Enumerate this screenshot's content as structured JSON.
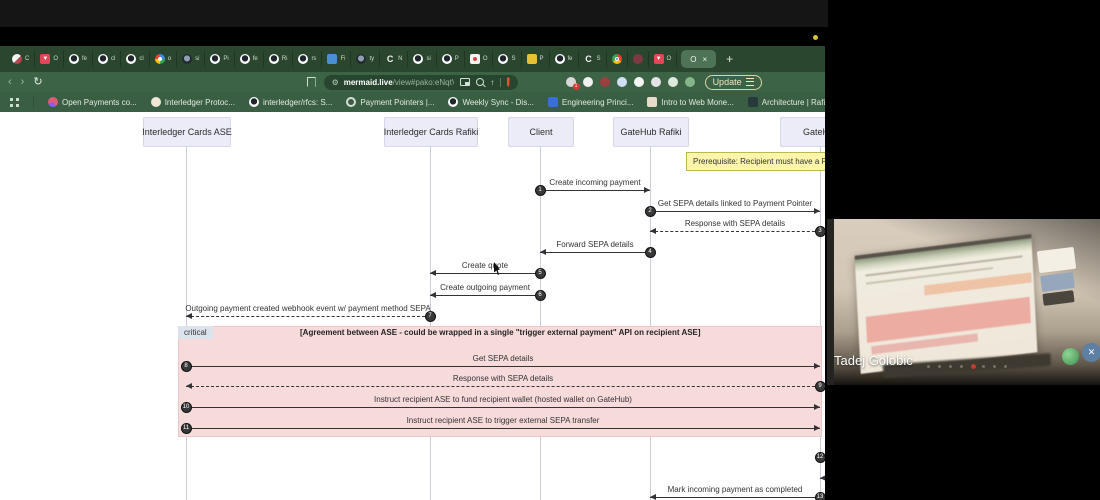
{
  "colors": {
    "brand_green": "#3d6347",
    "tabstrip_green": "#2a462f",
    "actor_fill": "#ececf8",
    "note_fill": "#fcf4a9",
    "critical_fill": "#f7dbdb",
    "arrow": "#333333"
  },
  "browser": {
    "tabs": [
      {
        "icon": "half-red",
        "label": "C"
      },
      {
        "icon": "v-logo",
        "label": "O"
      },
      {
        "icon": "github",
        "label": "fe"
      },
      {
        "icon": "github",
        "label": "cl"
      },
      {
        "icon": "github",
        "label": "cl"
      },
      {
        "icon": "google",
        "label": "o"
      },
      {
        "icon": "github-dark",
        "label": "si"
      },
      {
        "icon": "github",
        "label": "Pi"
      },
      {
        "icon": "github",
        "label": "fe"
      },
      {
        "icon": "github",
        "label": "Ri"
      },
      {
        "icon": "github",
        "label": "rs"
      },
      {
        "icon": "blue-square",
        "label": "Fi"
      },
      {
        "icon": "github-dark",
        "label": "ty"
      },
      {
        "icon": "c-white",
        "label": "N"
      },
      {
        "icon": "github",
        "label": "si"
      },
      {
        "icon": "github",
        "label": "P"
      },
      {
        "icon": "white-square",
        "label": "O"
      },
      {
        "icon": "github",
        "label": "S"
      },
      {
        "icon": "yellow-square",
        "label": "P"
      },
      {
        "icon": "github",
        "label": "fe"
      },
      {
        "icon": "c-white",
        "label": "S"
      },
      {
        "icon": "chrome",
        "label": ""
      },
      {
        "icon": "maroon-dot",
        "label": ""
      },
      {
        "icon": "v-logo",
        "label": "O"
      }
    ],
    "active_tab": {
      "label": "O",
      "close_glyph": "×"
    },
    "new_tab_label": "+",
    "url": {
      "domain": "mermaid.live",
      "path": "/view#pako:eNqtVk1v2kAQ_Suj7SWRgIDBAXxAQjRNc0iLkp4qLos92CvsXbJeQ9i…"
    },
    "update_label": "Update",
    "bookmarks": [
      {
        "icon": "openpayments",
        "label": "Open Payments co..."
      },
      {
        "icon": "cream-dot",
        "label": "Interledger Protoc..."
      },
      {
        "icon": "github",
        "label": "interledger/rfcs: S..."
      },
      {
        "icon": "ring",
        "label": "Payment Pointers |..."
      },
      {
        "icon": "github",
        "label": "Weekly Sync - Dis..."
      },
      {
        "icon": "blue-doc",
        "label": "Engineering Princi..."
      },
      {
        "icon": "slides",
        "label": "Intro to Web Mone..."
      },
      {
        "icon": "rafiki",
        "label": "Architecture | Rafiki"
      }
    ],
    "extensions": [
      {
        "name": "extension-1",
        "color": "#d8d8d8",
        "badge": "1"
      },
      {
        "name": "extension-2",
        "color": "#f0f0f0",
        "badge": ""
      },
      {
        "name": "extension-3",
        "color": "#9c3f3f",
        "badge": ""
      },
      {
        "name": "extension-4",
        "color": "#cfe0f2",
        "badge": ""
      },
      {
        "name": "extension-5",
        "color": "#f7f7f7",
        "badge": ""
      },
      {
        "name": "extension-6",
        "color": "#e4e4e4",
        "badge": ""
      },
      {
        "name": "extension-7",
        "color": "#dfe8df",
        "badge": ""
      },
      {
        "name": "extension-8",
        "color": "#86b588",
        "badge": ""
      }
    ]
  },
  "diagram": {
    "participants": [
      "Interledger Cards ASE",
      "Interledger Cards Rafiki",
      "Client",
      "GateHub Rafiki",
      "GateHub"
    ],
    "note": "Prerequisite: Recipient must have a Payme",
    "messages": [
      {
        "num": "1",
        "from": "Client",
        "to": "GateHub Rafiki",
        "text": "Create incoming payment",
        "line": "solid"
      },
      {
        "num": "2",
        "from": "GateHub Rafiki",
        "to": "GateHub",
        "text": "Get SEPA details linked to Payment Pointer",
        "line": "solid"
      },
      {
        "num": "3",
        "from": "GateHub",
        "to": "GateHub Rafiki",
        "text": "Response with SEPA details",
        "line": "dashed"
      },
      {
        "num": "4",
        "from": "GateHub Rafiki",
        "to": "Client",
        "text": "Forward SEPA details",
        "line": "solid"
      },
      {
        "num": "5",
        "from": "Client",
        "to": "Interledger Cards Rafiki",
        "text": "Create quote",
        "line": "solid"
      },
      {
        "num": "6",
        "from": "Client",
        "to": "Interledger Cards Rafiki",
        "text": "Create outgoing payment",
        "line": "solid"
      },
      {
        "num": "7",
        "from": "Interledger Cards Rafiki",
        "to": "Interledger Cards ASE",
        "text": "Outgoing payment created webhook event w/ payment method SEPA",
        "line": "dashed"
      }
    ],
    "critical": {
      "label": "critical",
      "title": "[Agreement between ASE - could be wrapped in a single \"trigger external payment\" API on recipient ASE]",
      "messages": [
        {
          "num": "8",
          "from": "Interledger Cards ASE",
          "to": "GateHub",
          "text": "Get SEPA details",
          "line": "solid"
        },
        {
          "num": "9",
          "from": "GateHub",
          "to": "Interledger Cards ASE",
          "text": "Response with SEPA details",
          "line": "dashed"
        },
        {
          "num": "10",
          "from": "Interledger Cards ASE",
          "to": "GateHub",
          "text": "Instruct recipient ASE to fund recipient wallet (hosted wallet on GateHub)",
          "line": "solid"
        },
        {
          "num": "11",
          "from": "Interledger Cards ASE",
          "to": "GateHub",
          "text": "Instruct recipient ASE to trigger external SEPA transfer",
          "line": "solid"
        }
      ]
    },
    "bottom_messages": [
      {
        "num": "12",
        "from": "GateHub",
        "to": "offscreen-right",
        "text": "",
        "line": "solid"
      },
      {
        "num": "",
        "from": "offscreen-right",
        "to": "GateHub",
        "text": "",
        "line": "dashed"
      },
      {
        "num": "13",
        "from": "GateHub",
        "to": "GateHub Rafiki",
        "text": "Mark incoming payment as completed",
        "line": "solid"
      }
    ]
  },
  "webcam": {
    "participant_name": "Tadej Golobic"
  }
}
